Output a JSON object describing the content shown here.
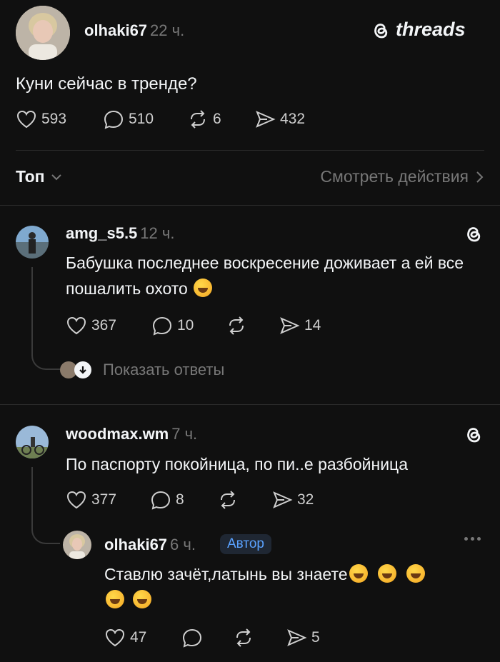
{
  "header": {
    "username": "olhaki67",
    "time": "22 ч.",
    "brand": "threads"
  },
  "post": {
    "text": "Куни сейчас в тренде?",
    "likes": "593",
    "comments": "510",
    "reposts": "6",
    "shares": "432"
  },
  "filter": {
    "sort_label": "Топ",
    "activity_link": "Смотреть действия"
  },
  "comments": [
    {
      "username": "amg_s5.5",
      "time": "12 ч.",
      "text": "Бабушка последнее воскресение доживает а ей все пошалить охото",
      "likes": "367",
      "comments": "10",
      "reposts": "",
      "shares": "14",
      "show_replies": "Показать ответы"
    },
    {
      "username": "woodmax.wm",
      "time": "7 ч.",
      "text": "По паспорту покойница, по пи..е разбойница",
      "likes": "377",
      "comments": "8",
      "reposts": "",
      "shares": "32"
    }
  ],
  "reply": {
    "username": "olhaki67",
    "time": "6 ч.",
    "badge": "Автор",
    "text": "Ставлю зачёт,латынь вы знаете",
    "likes": "47",
    "comments": "",
    "reposts": "",
    "shares": "5"
  },
  "colors": {
    "background": "#101010",
    "text": "#f3f5f7",
    "muted": "#777777",
    "badge": "#5aa2ff"
  }
}
